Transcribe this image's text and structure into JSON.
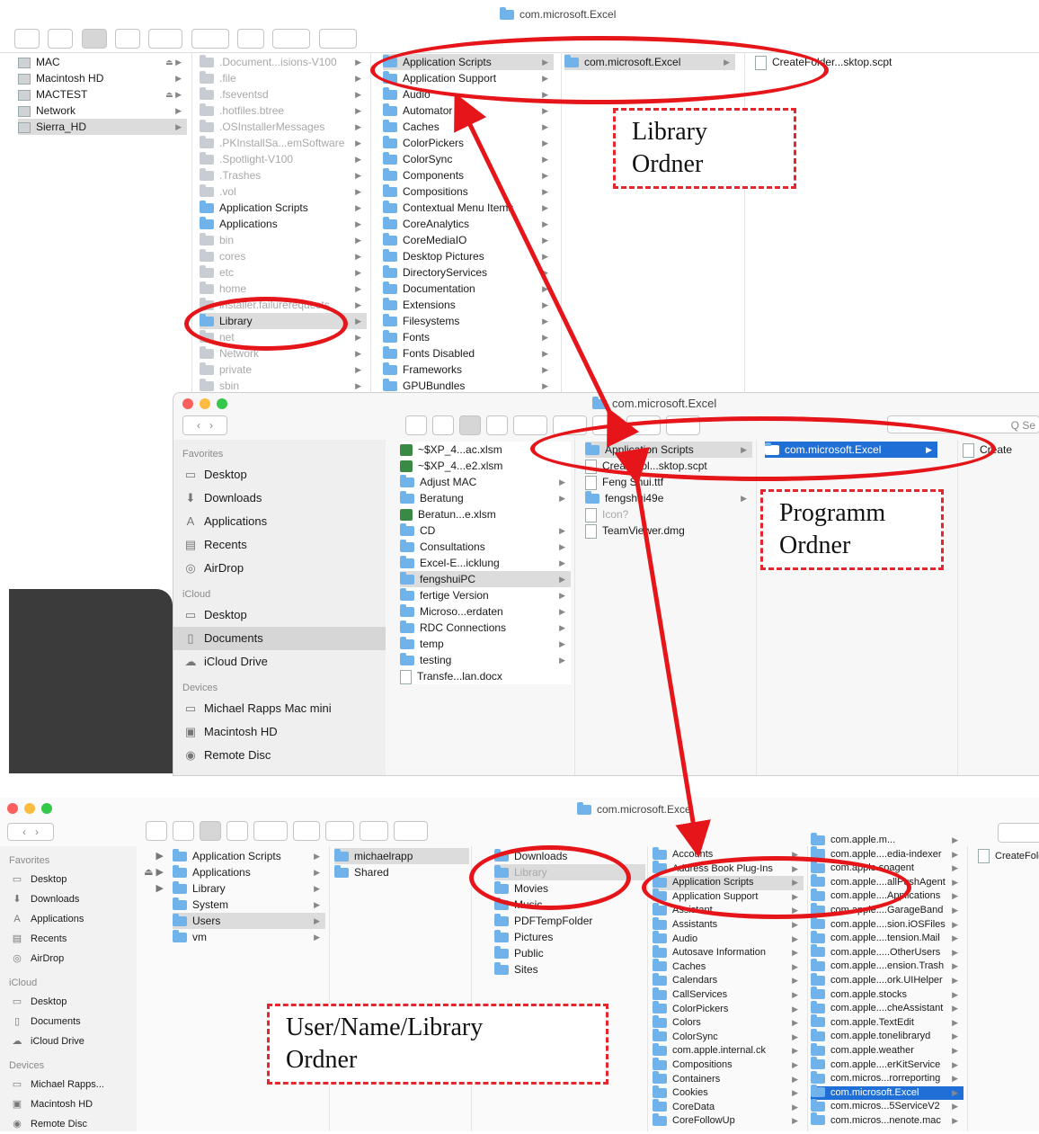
{
  "top_window": {
    "title": "com.microsoft.Excel",
    "devices": [
      {
        "label": "MAC",
        "eject": true
      },
      {
        "label": "Macintosh HD",
        "eject": false
      },
      {
        "label": "MACTEST",
        "eject": true
      },
      {
        "label": "Network",
        "eject": false
      },
      {
        "label": "Sierra_HD",
        "eject": false
      }
    ],
    "root_items": [
      {
        "label": ".Document...isions-V100",
        "dim": true
      },
      {
        "label": ".file",
        "dim": true
      },
      {
        "label": ".fseventsd",
        "dim": true
      },
      {
        "label": ".hotfiles.btree",
        "dim": true
      },
      {
        "label": ".OSInstallerMessages",
        "dim": true
      },
      {
        "label": ".PKInstallSa...emSoftware",
        "dim": true
      },
      {
        "label": ".Spotlight-V100",
        "dim": true
      },
      {
        "label": ".Trashes",
        "dim": true
      },
      {
        "label": ".vol",
        "dim": true
      },
      {
        "label": "Application Scripts",
        "dim": false
      },
      {
        "label": "Applications",
        "dim": false
      },
      {
        "label": "bin",
        "dim": true
      },
      {
        "label": "cores",
        "dim": true
      },
      {
        "label": "etc",
        "dim": true
      },
      {
        "label": "home",
        "dim": true
      },
      {
        "label": "installer.failurerequests",
        "dim": true
      },
      {
        "label": "Library",
        "dim": false,
        "selected": true
      },
      {
        "label": "net",
        "dim": true
      },
      {
        "label": "Network",
        "dim": true
      },
      {
        "label": "private",
        "dim": true
      },
      {
        "label": "sbin",
        "dim": true
      }
    ],
    "library_items": [
      "Application Scripts",
      "Application Support",
      "Audio",
      "Automator",
      "Caches",
      "ColorPickers",
      "ColorSync",
      "Components",
      "Compositions",
      "Contextual Menu Items",
      "CoreAnalytics",
      "CoreMediaIO",
      "Desktop Pictures",
      "DirectoryServices",
      "Documentation",
      "Extensions",
      "Filesystems",
      "Fonts",
      "Fonts Disabled",
      "Frameworks",
      "GPUBundles"
    ],
    "col3_item": "com.microsoft.Excel",
    "col4_item": "CreateFolder...sktop.scpt"
  },
  "middle_window": {
    "title": "com.microsoft.Excel",
    "search_placeholder": "Se",
    "sidebar": {
      "favorites_header": "Favorites",
      "favorites": [
        "Desktop",
        "Downloads",
        "Applications",
        "Recents",
        "AirDrop"
      ],
      "icloud_header": "iCloud",
      "icloud": [
        "Desktop",
        "Documents",
        "iCloud Drive"
      ],
      "devices_header": "Devices",
      "devices": [
        "Michael Rapps Mac mini",
        "Macintosh HD",
        "Remote Disc"
      ]
    },
    "files": [
      "~$XP_4...ac.xlsm",
      "~$XP_4...e2.xlsm",
      "Adjust MAC",
      "Beratung",
      "Beratun...e.xlsm",
      "CD",
      "Consultations",
      "Excel-E...icklung",
      "fengshuiPC",
      "fertige Version",
      "Microso...erdaten",
      "RDC Connections",
      "temp",
      "testing",
      "Transfe...lan.docx"
    ],
    "col2": [
      "Application Scripts",
      "CreateFol...sktop.scpt",
      "Feng Shui.ttf",
      "fengshui49e",
      "Icon?",
      "TeamViewer.dmg"
    ],
    "col3_item": "com.microsoft.Excel",
    "col4_item": "Create"
  },
  "bottom_window": {
    "title": "com.microsoft.Excel",
    "sidebar": {
      "favorites_header": "Favorites",
      "favorites": [
        "Desktop",
        "Downloads",
        "Applications",
        "Recents",
        "AirDrop"
      ],
      "icloud_header": "iCloud",
      "icloud": [
        "Desktop",
        "Documents",
        "iCloud Drive"
      ],
      "devices_header": "Devices",
      "devices": [
        "Michael Rapps...",
        "Macintosh HD",
        "Remote Disc"
      ]
    },
    "root": [
      "Application Scripts",
      "Applications",
      "Library",
      "System",
      "Users",
      "vm"
    ],
    "users": [
      "michaelrapp",
      "Shared"
    ],
    "home": [
      "Downloads",
      "Library",
      "Movies",
      "Music",
      "PDFTempFolder",
      "Pictures",
      "Public",
      "Sites"
    ],
    "library": [
      "Accounts",
      "Address Book Plug-Ins",
      "Application Scripts",
      "Application Support",
      "Assistant",
      "Assistants",
      "Audio",
      "Autosave Information",
      "Caches",
      "Calendars",
      "CallServices",
      "ColorPickers",
      "Colors",
      "ColorSync",
      "com.apple.internal.ck",
      "Compositions",
      "Containers",
      "Cookies",
      "CoreData",
      "CoreFollowUp"
    ],
    "scripts": [
      "com.apple.m...",
      "com.apple....edia-indexer",
      "com.apple.soagent",
      "com.apple....allPushAgent",
      "com.apple....Applications",
      "com.apple....GarageBand",
      "com.apple....sion.iOSFiles",
      "com.apple....tension.Mail",
      "com.apple.....OtherUsers",
      "com.apple....ension.Trash",
      "com.apple....ork.UIHelper",
      "com.apple.stocks",
      "com.apple....cheAssistant",
      "com.apple.TextEdit",
      "com.apple.tonelibraryd",
      "com.apple.weather",
      "com.apple....erKitService",
      "com.micros...rorreporting",
      "com.microsoft.Excel",
      "com.micros...5ServiceV2",
      "com.micros...nenote.mac"
    ],
    "col6_item": "CreateFold"
  },
  "annotations": {
    "library_label": "Library\nOrdner",
    "programm_label": "Programm\nOrdner",
    "user_label": "User/Name/Library\nOrdner"
  },
  "colors": {
    "annotation_red": "#e5151a",
    "folder_blue": "#6fb3ea",
    "selection_blue": "#1f6fd6"
  }
}
